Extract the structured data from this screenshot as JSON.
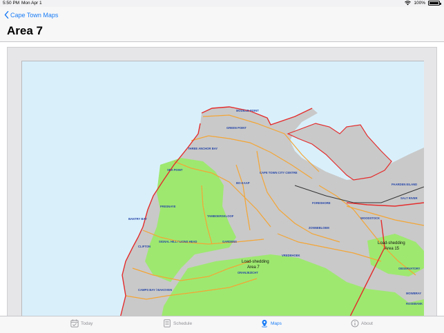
{
  "status_bar": {
    "time": "5:50 PM",
    "date": "Mon Apr 1",
    "battery": "100%"
  },
  "nav": {
    "back_label": "Cape Town Maps",
    "title": "Area 7"
  },
  "map": {
    "labels": [
      "MOUILLE POINT",
      "GREEN POINT",
      "THREE ANCHOR BAY",
      "SEA POINT",
      "CAPE TOWN CITY CENTRE",
      "BO-KAAP",
      "PAARDEN EILAND",
      "SALT RIVER",
      "FORESHORE",
      "WOODSTOCK",
      "FRESNAYE",
      "BANTRY BAY",
      "TAMBOERSKLOOF",
      "ZONNEBLOEM",
      "CLIFTON",
      "SIGNAL HILL / LIONS HEAD",
      "GARDENS",
      "VREDEHOEK",
      "OBSERVATORY",
      "ORANJEZICHT",
      "CAMPS BAY / BAKOVEN",
      "MOWBRAY",
      "ROSEBANK"
    ],
    "area7": [
      "Load-shedding",
      "Area 7"
    ],
    "area15": [
      "Load-shedding",
      "Area 15"
    ]
  },
  "tabs": [
    {
      "label": "Today"
    },
    {
      "label": "Schedule"
    },
    {
      "label": "Maps"
    },
    {
      "label": "About"
    }
  ],
  "colors": {
    "accent": "#1a7cf5",
    "sea": "#d9f0fb",
    "park": "#9ee870",
    "land": "#c8c8c8",
    "road": "#f4a534",
    "boundary": "#e52b2b"
  }
}
